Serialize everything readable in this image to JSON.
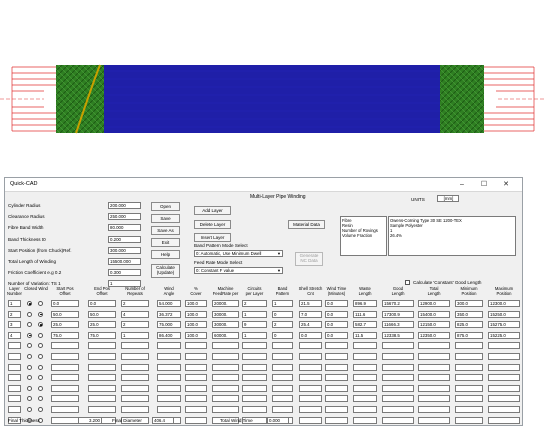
{
  "window": {
    "title": "Quick-CAD",
    "heading": "Multi-Layer Pipe Winding",
    "minimize_glyph": "–",
    "maximize_glyph": "☐",
    "close_glyph": "✕"
  },
  "units": {
    "label": "UNITS",
    "value": "[mm]"
  },
  "params": [
    {
      "label": "Cylinder Radius",
      "value": "200.000"
    },
    {
      "label": "Clearance Radius",
      "value": "250.000"
    },
    {
      "label": "Fibre Band Width",
      "value": "80.000"
    },
    {
      "label": "Band Thickness t0",
      "value": "0.200"
    },
    {
      "label": "Start Position (from Chuck)Ref.",
      "value": "300.000"
    },
    {
      "label": "Total Length of Winding",
      "value": "15500.000"
    },
    {
      "label": "Friction Coefficient e.g 0.2",
      "value": "0.300"
    },
    {
      "label": "Number of Variation: TS 1",
      "value": "1"
    }
  ],
  "buttons": {
    "open": "Open",
    "save": "Save",
    "save_as": "Save As",
    "exit": "Exit",
    "help": "Help",
    "calculate": "Calculate\n(Update)",
    "add_layer": "Add Layer",
    "delete_layer": "Delete Layer",
    "insert_layer": "Insert Layer",
    "material_data": "Material Data",
    "generate_nc": "Generate NC Data"
  },
  "band_pattern": {
    "label": "Band Pattern Mode Select",
    "value": "0: Automatic, Use Minimum Dwell"
  },
  "feed_rate": {
    "label": "Feed Rate Mode Select",
    "value": "0: Constant F value"
  },
  "material": {
    "labels": [
      "Fibre",
      "Resin",
      "Number of Rovings",
      "Volume Fraction"
    ],
    "values": [
      "Owens-Corning Type 30 SE 1200-TEX",
      "Sample Polyester",
      "1",
      "26.4%"
    ]
  },
  "calc_good_length": "Calculate 'Constant' Good Length",
  "table": {
    "headers": [
      "Layer\nNumber",
      "Closed Wind",
      "Start Pos\nOffset",
      "End Pos\nOffset",
      "Number of\nRepeats",
      "Wind\nAngle",
      "%\nCover",
      "Machine\nFeedRate per",
      "Circuits\nper Layer",
      "Band\nPattern",
      "Shell Stretch\nCnt",
      "Wind Time\n(Minutes)",
      "Waste\nLength",
      "Good\nLength",
      "Total\nLength",
      "Minimum\nPosition",
      "Maximum\nPosition"
    ],
    "rows": [
      {
        "num": "1",
        "closed": true,
        "start": "0.0",
        "end": "0.0",
        "repeats": "2",
        "angle": "54.000",
        "cover": "100.0",
        "feed": "20000.",
        "circuits": "2",
        "pattern": "1",
        "stretch": "21.5",
        "time": "0.0",
        "waste": "896.9",
        "good": "15670.2",
        "total": "12900.0",
        "minpos": "300.0",
        "maxpos": "12300.0"
      },
      {
        "num": "2",
        "closed": false,
        "start": "50.0",
        "end": "50.0",
        "repeats": "4",
        "angle": "36.372",
        "cover": "100.0",
        "feed": "30000.",
        "circuits": "1",
        "pattern": "0",
        "stretch": "7.0",
        "time": "0.0",
        "waste": "111.6",
        "good": "17300.9",
        "total": "15400.0",
        "minpos": "350.0",
        "maxpos": "15250.0"
      },
      {
        "num": "3",
        "closed": false,
        "start": "25.0",
        "end": "25.0",
        "repeats": "2",
        "angle": "75.000",
        "cover": "100.0",
        "feed": "30000.",
        "circuits": "9",
        "pattern": "2",
        "stretch": "25.4",
        "time": "0.0",
        "waste": "582.7",
        "good": "11666.3",
        "total": "12150.0",
        "minpos": "825.0",
        "maxpos": "15275.0"
      },
      {
        "num": "4",
        "closed": true,
        "start": "75.0",
        "end": "75.0",
        "repeats": "1",
        "angle": "86.400",
        "cover": "100.0",
        "feed": "60000.",
        "circuits": "1",
        "pattern": "0",
        "stretch": "0.0",
        "time": "0.0",
        "waste": "11.5",
        "good": "12338.5",
        "total": "12350.0",
        "minpos": "875.0",
        "maxpos": "15225.0"
      }
    ],
    "empty_rows": 8
  },
  "footer": {
    "thickness_label": "Final Thickness",
    "thickness_value": "3.200",
    "diameter_label": "Final Diameter",
    "diameter_value": "406.4",
    "wind_time_label": "Total Wind Time",
    "wind_time_value": "0.000"
  },
  "colors": {
    "pipe_blue": "#1f1fa8",
    "fibre_green": "#2e7d1e",
    "mandrel_red": "#e03030",
    "band_yellow": "#c8a000"
  }
}
